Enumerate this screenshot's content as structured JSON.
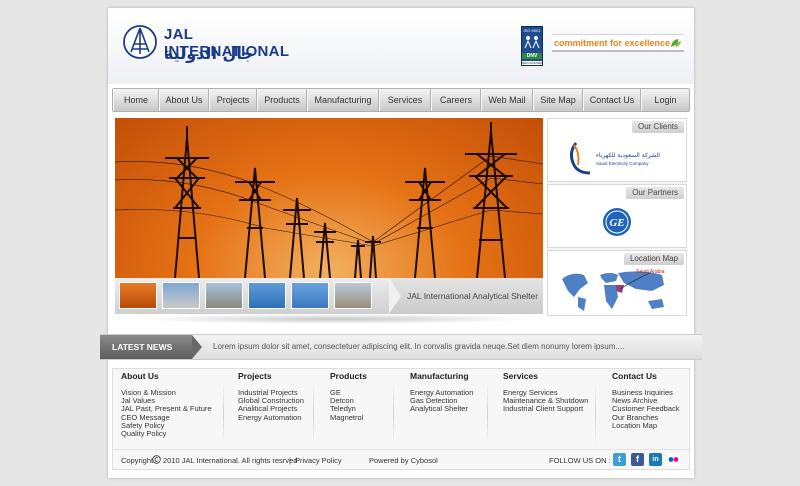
{
  "brand": {
    "name_en": "JAL INTERNATIONAL",
    "name_ar": "جال الدولية",
    "tagline": "commitment for excellence",
    "cert": {
      "top": "ISO 9001",
      "mark": "DNV",
      "bottom": "RECOGNISED"
    }
  },
  "nav": [
    "Home",
    "About Us",
    "Projects",
    "Products",
    "Manufacturing",
    "Services",
    "Careers",
    "Web Mail",
    "Site Map",
    "Contact Us",
    "Login"
  ],
  "banner": {
    "caption": "JAL International Analytical Shelter"
  },
  "sidebar": {
    "clients": {
      "title": "Our Clients",
      "logo_ar": "الشركة السعودية للكهرباء",
      "logo_en": "Saudi Electricity Company"
    },
    "partners": {
      "title": "Our Partners",
      "logo": "GE"
    },
    "location": {
      "title": "Location Map",
      "pin_label": "Saudi Arabia"
    }
  },
  "news": {
    "label": "LATEST NEWS",
    "text": "Lorem ipsum dolor sit amet, consectetuer adipiscing elit. In convalis gravida neuqe.Set diem nonumy lorem ipsum...."
  },
  "footer": {
    "columns": [
      {
        "title": "About Us",
        "items": [
          "Vision & Mission",
          "Jal Values",
          "JAL Past, Present & Future",
          "CEO Message",
          "Safety Policy",
          "Quality Policy"
        ]
      },
      {
        "title": "Projects",
        "items": [
          "Industrial Projects",
          "Global Construction",
          "Analitical Projects",
          "Energy Automation"
        ]
      },
      {
        "title": "Products",
        "items": [
          "GE",
          "Detcon",
          "Teledyn",
          "Magnetrol"
        ]
      },
      {
        "title": "Manufacturing",
        "items": [
          "Energy Automation",
          "Gas Detection",
          "Analytical Shelter"
        ]
      },
      {
        "title": "Services",
        "items": [
          "Energy Services",
          "Maintenance & Shutdown",
          "Industrial Client Support"
        ]
      },
      {
        "title": "Contact Us",
        "items": [
          "Business Inquiries",
          "News Archive",
          "Customer Feedback",
          "Our Branches",
          "Location Map"
        ]
      }
    ],
    "copyright_prefix": "Copyright",
    "copyright_text": "2010 JAL International. All rights resrved",
    "divider": "|",
    "privacy": "Privacy Policy",
    "powered": "Powered by Cybosol",
    "follow": "FOLLOW US ON :",
    "social": [
      {
        "name": "twitter",
        "glyph": "t",
        "color": "#3c9fd8"
      },
      {
        "name": "facebook",
        "glyph": "f",
        "color": "#3b5998"
      },
      {
        "name": "linkedin",
        "glyph": "in",
        "color": "#1d79b6"
      },
      {
        "name": "flickr",
        "glyph": "●●",
        "color": "#ffffff"
      }
    ]
  }
}
